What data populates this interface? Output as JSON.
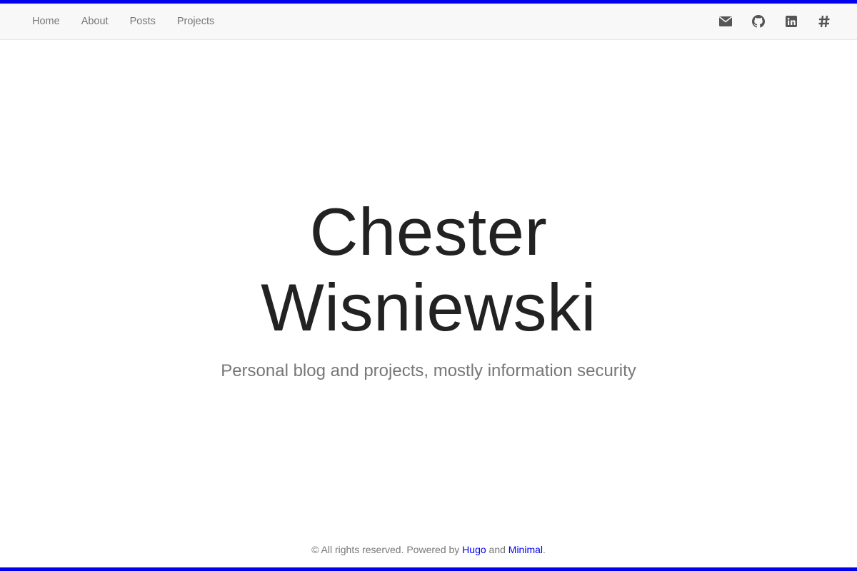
{
  "nav": {
    "links": [
      {
        "label": "Home"
      },
      {
        "label": "About"
      },
      {
        "label": "Posts"
      },
      {
        "label": "Projects"
      }
    ],
    "icons": [
      {
        "name": "envelope-icon"
      },
      {
        "name": "github-icon"
      },
      {
        "name": "linkedin-icon"
      },
      {
        "name": "hashtag-icon"
      }
    ]
  },
  "hero": {
    "title_line1": "Chester",
    "title_line2": "Wisniewski",
    "subtitle": "Personal blog and projects, mostly information security"
  },
  "footer": {
    "copyright": "© All rights reserved. Powered by ",
    "hugo_link": "Hugo",
    "and_text": " and ",
    "minimal_link": "Minimal",
    "end_text": "."
  },
  "colors": {
    "accent": "#0000ee",
    "navbar_bg": "#f8f8f8",
    "title": "#222222",
    "muted": "#777777"
  }
}
